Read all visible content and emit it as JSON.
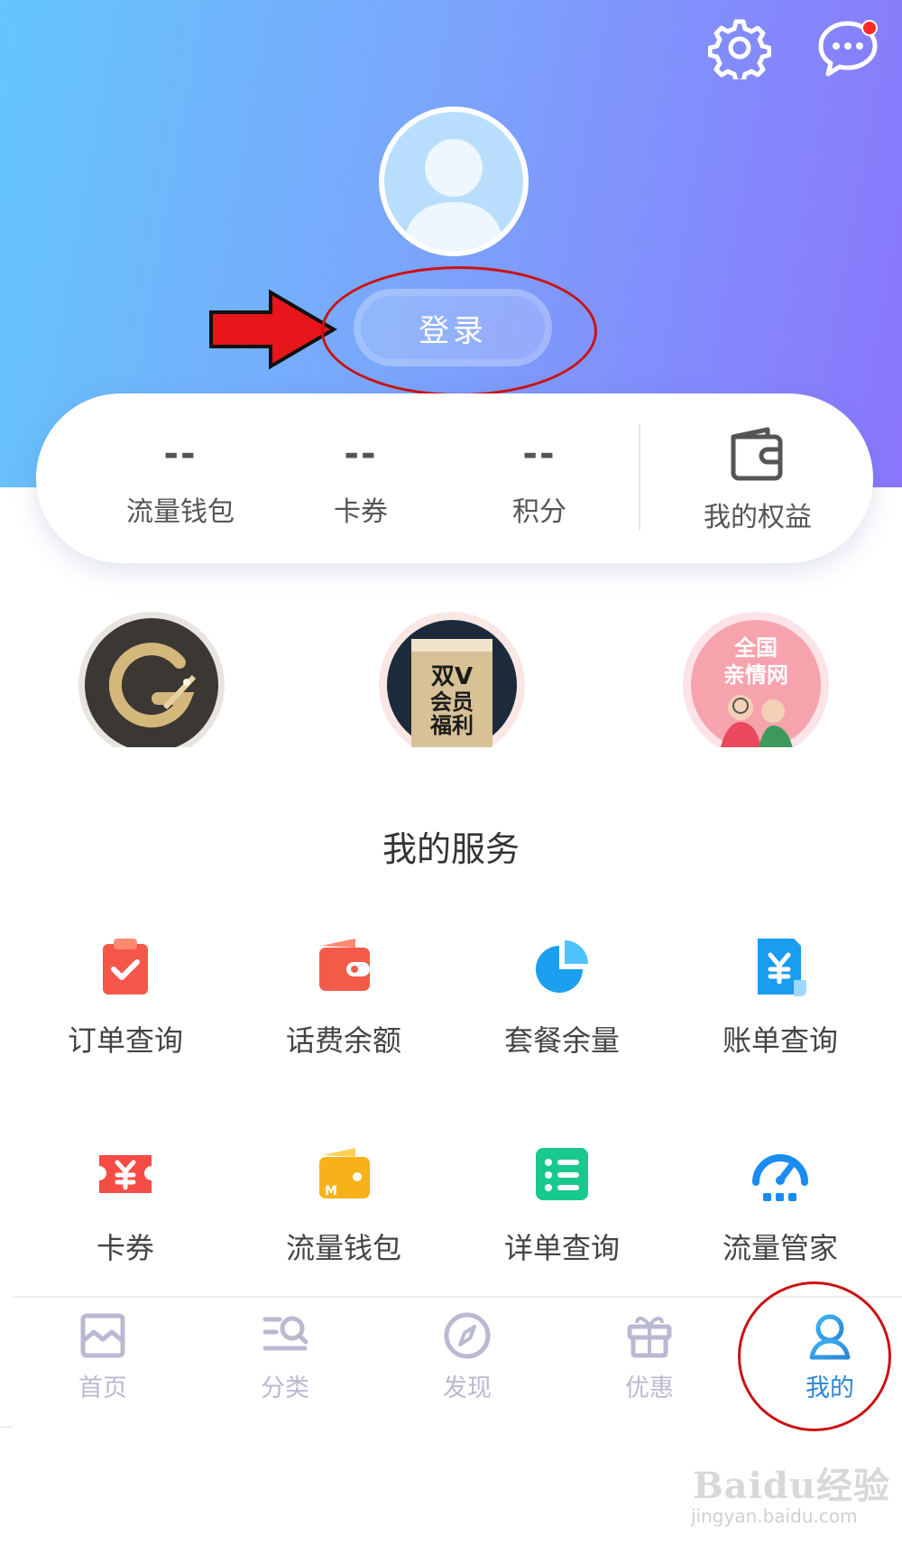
{
  "header": {
    "login_label": "登录",
    "settings_icon": "gear-icon",
    "messages_icon": "chat-bubble-icon",
    "has_unread_badge": true
  },
  "stats": [
    {
      "value": "--",
      "label": "流量钱包"
    },
    {
      "value": "--",
      "label": "卡券"
    },
    {
      "value": "--",
      "label": "积分"
    }
  ],
  "rights": {
    "label": "我的权益",
    "icon": "wallet-icon"
  },
  "promos": [
    {
      "name": "golden-g-logo"
    },
    {
      "name": "double-v-member-benefits",
      "text": "双V会员福利"
    },
    {
      "name": "family-network-banner",
      "text": "全国亲情网"
    }
  ],
  "services_title": "我的服务",
  "services": [
    {
      "label": "订单查询",
      "icon": "clipboard-check-icon",
      "color": "#f5564a"
    },
    {
      "label": "话费余额",
      "icon": "wallet-icon",
      "color": "#f35b48"
    },
    {
      "label": "套餐余量",
      "icon": "pie-chart-icon",
      "color": "#1aa0ee"
    },
    {
      "label": "账单查询",
      "icon": "bill-yen-icon",
      "color": "#1a9cef"
    },
    {
      "label": "卡券",
      "icon": "coupon-yen-icon",
      "color": "#f54c45"
    },
    {
      "label": "流量钱包",
      "icon": "data-wallet-icon",
      "color": "#f7b21a"
    },
    {
      "label": "详单查询",
      "icon": "list-detail-icon",
      "color": "#19c98b"
    },
    {
      "label": "流量管家",
      "icon": "speedometer-icon",
      "color": "#1a8bf0"
    }
  ],
  "nav": [
    {
      "label": "首页",
      "icon": "home-icon"
    },
    {
      "label": "分类",
      "icon": "category-search-icon"
    },
    {
      "label": "发现",
      "icon": "compass-icon"
    },
    {
      "label": "优惠",
      "icon": "gift-icon"
    },
    {
      "label": "我的",
      "icon": "user-icon",
      "active": true
    }
  ],
  "colors": {
    "header_gradient_start": "#64c6fd",
    "header_gradient_end": "#8a76fc",
    "nav_active": "#2b86d8",
    "nav_inactive": "#b9b9d2",
    "annotation_red": "#cc1111"
  },
  "watermark": {
    "brand": "Baidu经验",
    "url": "jingyan.baidu.com"
  }
}
